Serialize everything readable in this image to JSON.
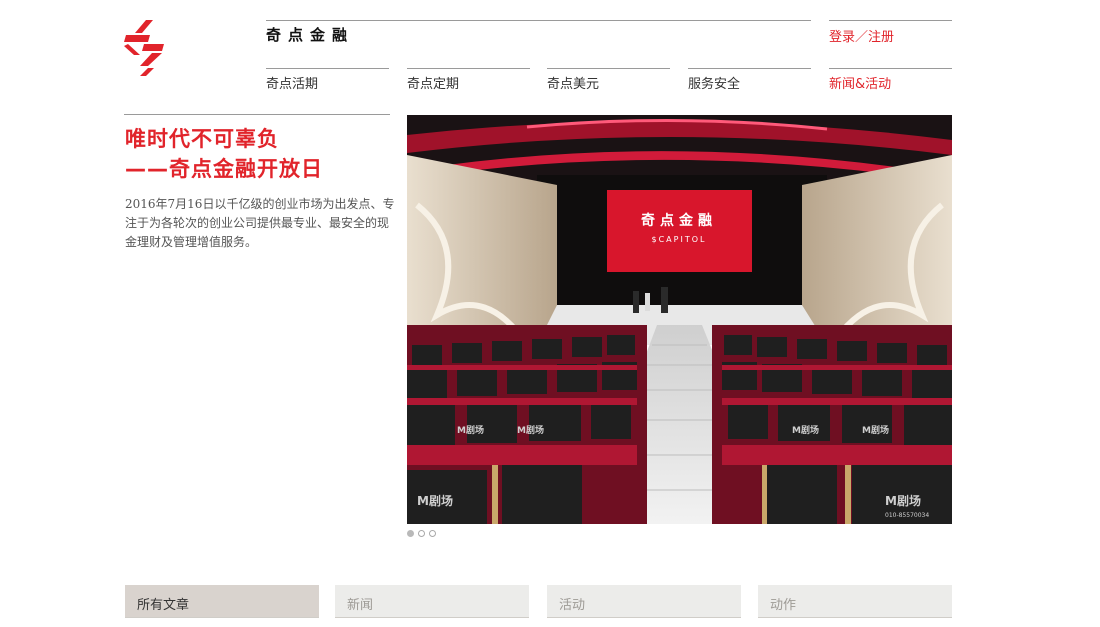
{
  "brand": {
    "name": "奇点金融"
  },
  "header": {
    "login_register": "登录／注册"
  },
  "nav": {
    "items": [
      {
        "label": "奇点活期"
      },
      {
        "label": "奇点定期"
      },
      {
        "label": "奇点美元"
      },
      {
        "label": "服务安全"
      },
      {
        "label": "新闻&活动",
        "active": true
      }
    ]
  },
  "article": {
    "title_line1": "唯时代不可辜负",
    "title_line2": "——奇点金融开放日",
    "description": "2016年7月16日以千亿级的创业市场为出发点、专注于为各轮次的创业公司提供最专业、最安全的现金理财及管理增值服务。"
  },
  "photo": {
    "screen_title": "奇点金融",
    "screen_subtitle": "$CAPITOL",
    "seat_brand": "M剧场",
    "seat_phone": "010-85570034"
  },
  "carousel": {
    "count": 3,
    "active_index": 0
  },
  "filters": {
    "tabs": [
      {
        "label": "所有文章",
        "active": true
      },
      {
        "label": "新闻"
      },
      {
        "label": "活动"
      },
      {
        "label": "动作"
      }
    ]
  },
  "colors": {
    "accent": "#e1242b",
    "tab_active_bg": "#d9d3ce",
    "tab_bg": "#ececea"
  }
}
